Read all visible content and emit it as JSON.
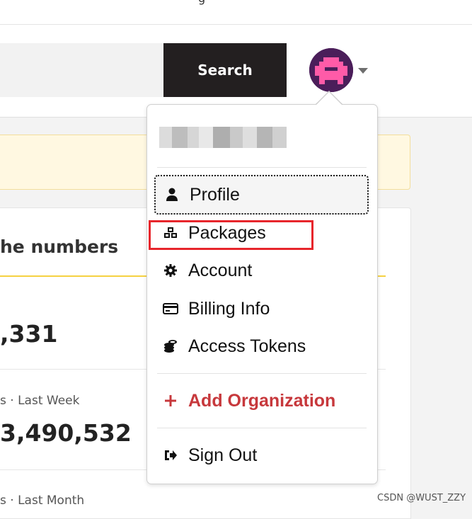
{
  "topbar": {
    "partial_text": "g"
  },
  "header": {
    "search_button": "Search"
  },
  "stats": {
    "title": "he numbers",
    "items": [
      {
        "value": ",331"
      },
      {
        "label": "s · Last Week",
        "value": "3,490,532"
      },
      {
        "label": "s · Last Month"
      }
    ]
  },
  "dropdown": {
    "items": [
      {
        "label": "Profile",
        "icon": "user-icon"
      },
      {
        "label": "Packages",
        "icon": "packages-icon"
      },
      {
        "label": "Account",
        "icon": "gear-icon"
      },
      {
        "label": "Billing Info",
        "icon": "credit-card-icon"
      },
      {
        "label": "Access Tokens",
        "icon": "coins-icon"
      },
      {
        "label": "Add Organization",
        "icon": "plus-icon"
      },
      {
        "label": "Sign Out",
        "icon": "sign-out-icon"
      }
    ]
  },
  "colors": {
    "accent": "#c7383c",
    "search_button_bg": "#231f20",
    "highlight": "#e7262c",
    "underline": "#f5d142"
  },
  "watermark": "CSDN @WUST_ZZY"
}
